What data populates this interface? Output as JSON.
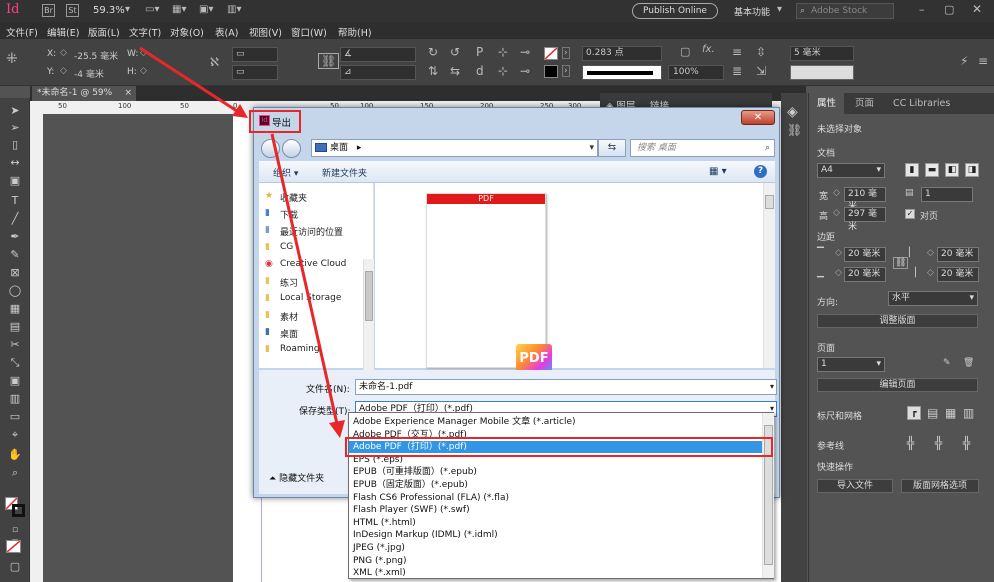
{
  "app": {
    "logo": "Id",
    "bridge_label": "Br",
    "stock_label": "St",
    "zoom": "59.3%",
    "publish_online": "Publish Online",
    "workspace": "基本功能",
    "search_placeholder": "Adobe Stock"
  },
  "menu": {
    "items": [
      "文件(F)",
      "编辑(E)",
      "版面(L)",
      "文字(T)",
      "对象(O)",
      "表(A)",
      "视图(V)",
      "窗口(W)",
      "帮助(H)"
    ]
  },
  "control_bar": {
    "x_label": "X:",
    "x_value": "-25.5 毫米",
    "y_label": "Y:",
    "y_value": "-4 毫米",
    "w_label": "W:",
    "h_label": "H:",
    "stroke_weight": "0.283 点",
    "opacity": "100%",
    "gap_value": "5 毫米"
  },
  "document_tab": {
    "label": "*未命名-1 @ 59%",
    "close": "×"
  },
  "ruler": {
    "ticks": [
      "50",
      "100",
      "50",
      "0",
      "50",
      "100",
      "150",
      "200",
      "250",
      "300"
    ]
  },
  "mid_panel": {
    "tabs": [
      "图层",
      "链接"
    ]
  },
  "right_panel": {
    "tabs": [
      "属性",
      "页面",
      "CC Libraries"
    ],
    "no_selection": "未选择对象",
    "document_section": "文档",
    "page_size": "A4",
    "width_label": "宽",
    "width_value": "210 毫米",
    "height_label": "高",
    "height_value": "297 毫米",
    "pages_value": "1",
    "facing_pages": "对页",
    "margins_section": "边距",
    "margin_top": "20 毫米",
    "margin_bottom": "20 毫米",
    "margin_left": "20 毫米",
    "margin_right": "20 毫米",
    "orientation_label": "方向:",
    "orientation_value": "水平",
    "adjust_layout": "调整版面",
    "page_section": "页面",
    "page_value": "1",
    "edit_page": "编辑页面",
    "rulers_grids": "标尺和网格",
    "guides": "参考线",
    "quick_actions": "快速操作",
    "import_file": "导入文件",
    "layout_grid_options": "版面网格选项"
  },
  "dialog": {
    "title": "导出",
    "close": "✕",
    "address": "桌面",
    "address_arrow": "▸",
    "search_placeholder": "搜索 桌面",
    "organize": "组织 ▾",
    "new_folder": "新建文件夹",
    "nav_items": [
      {
        "label": "收藏夹",
        "icon": "★",
        "color": "#e2b43a"
      },
      {
        "label": "下载",
        "icon": "▮",
        "color": "#4b7fd0"
      },
      {
        "label": "最近访问的位置",
        "icon": "▮",
        "color": "#7a9bc5"
      },
      {
        "label": "CG",
        "icon": "▮",
        "color": "#e8c25a"
      },
      {
        "label": "Creative Cloud",
        "icon": "◉",
        "color": "#e2313a"
      },
      {
        "label": "练习",
        "icon": "▮",
        "color": "#e8c25a"
      },
      {
        "label": "Local Storage",
        "icon": "▮",
        "color": "#e8c25a"
      },
      {
        "label": "素材",
        "icon": "▮",
        "color": "#e8c25a"
      },
      {
        "label": "桌面",
        "icon": "▮",
        "color": "#3e6fb8"
      },
      {
        "label": "Roaming",
        "icon": "▮",
        "color": "#e8c25a"
      }
    ],
    "thumb_label": "PDF",
    "thumb_icon_text": "PDF",
    "filename_label": "文件名(N):",
    "filename_value": "未命名-1.pdf",
    "savetype_label": "保存类型(T):",
    "savetype_value": "Adobe PDF（打印）(*.pdf)",
    "hide_folders": "隐藏文件夹"
  },
  "type_list": {
    "options": [
      "Adobe Experience Manager Mobile 文章 (*.article)",
      "Adobe PDF（交互）(*.pdf)",
      "Adobe PDF（打印）(*.pdf)",
      "EPS (*.eps)",
      "EPUB（可重排版面）(*.epub)",
      "EPUB（固定版面）(*.epub)",
      "Flash CS6 Professional (FLA) (*.fla)",
      "Flash Player (SWF) (*.swf)",
      "HTML (*.html)",
      "InDesign Markup (IDML) (*.idml)",
      "JPEG (*.jpg)",
      "PNG (*.png)",
      "XML (*.xml)"
    ],
    "selected_index": 2
  },
  "colors": {
    "annotation_red": "#e8272a",
    "highlight_blue": "#3296e6",
    "indesign_pink": "#ff3d8b"
  }
}
